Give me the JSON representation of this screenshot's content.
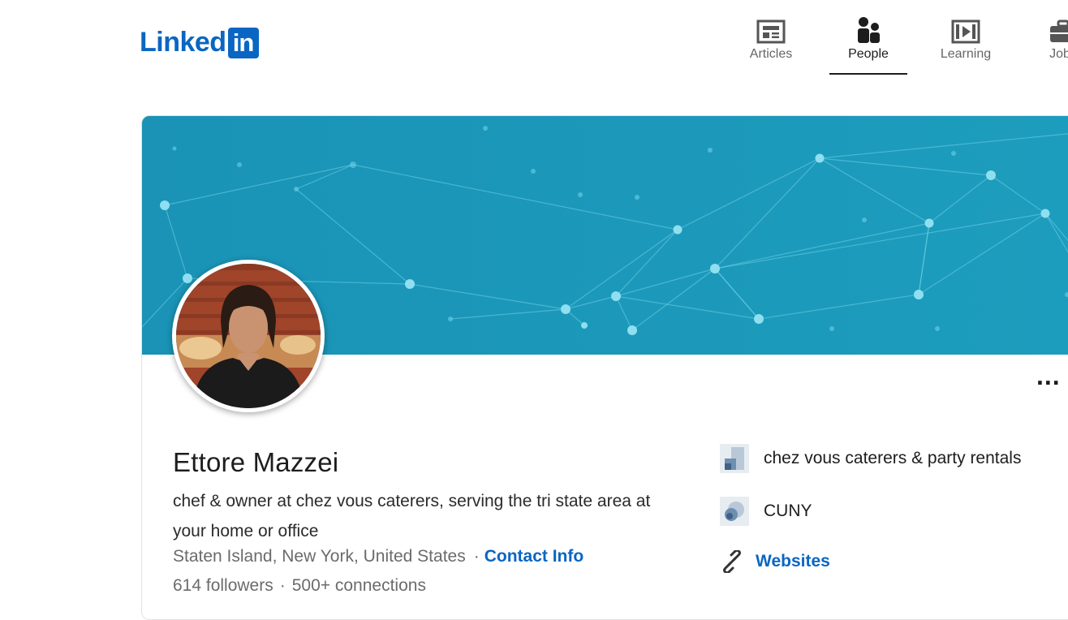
{
  "brand": {
    "logo_text": "Linked",
    "logo_box_text": "in",
    "color": "#0a66c2"
  },
  "nav": {
    "items": [
      {
        "label": "Articles",
        "icon": "article-icon",
        "active": false
      },
      {
        "label": "People",
        "icon": "people-icon",
        "active": true
      },
      {
        "label": "Learning",
        "icon": "learning-icon",
        "active": false
      },
      {
        "label": "Jobs",
        "icon": "briefcase-icon",
        "active": false
      }
    ]
  },
  "profile": {
    "name": "Ettore Mazzei",
    "headline": "chef & owner at chez vous caterers, serving the tri state area at your home or office",
    "location": "Staten Island, New York, United States",
    "contact_info_label": "Contact Info",
    "followers": "614 followers",
    "connections": "500+ connections",
    "more_label": "...",
    "current_company": "chez vous caterers & party rentals",
    "education": "CUNY",
    "websites_label": "Websites"
  },
  "colors": {
    "banner": "#1796b6",
    "link": "#0a66c2",
    "muted_text": "#6b6b6b"
  }
}
